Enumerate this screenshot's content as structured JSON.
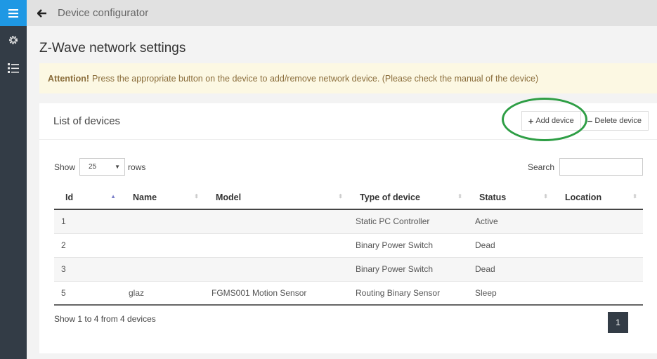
{
  "topbar": {
    "title": "Device configurator"
  },
  "page": {
    "title": "Z-Wave network settings"
  },
  "alert": {
    "strong": "Attention!",
    "text": "Press the appropriate button on the device to add/remove network device. (Please check the manual of the device)"
  },
  "card": {
    "title": "List of devices",
    "add_icon": "+",
    "add_label": "Add device",
    "delete_icon": "−",
    "delete_label": "Delete device"
  },
  "controls": {
    "show_label": "Show",
    "rows_value": "25",
    "rows_label": "rows",
    "search_label": "Search",
    "search_value": ""
  },
  "table": {
    "headers": [
      "Id",
      "Name",
      "Model",
      "Type of device",
      "Status",
      "Location"
    ],
    "rows": [
      [
        "1",
        "",
        "",
        "Static PC Controller",
        "Active",
        ""
      ],
      [
        "2",
        "",
        "",
        "Binary Power Switch",
        "Dead",
        ""
      ],
      [
        "3",
        "",
        "",
        "Binary Power Switch",
        "Dead",
        ""
      ],
      [
        "5",
        "glaz",
        "FGMS001 Motion Sensor",
        "Routing Binary Sensor",
        "Sleep",
        ""
      ]
    ]
  },
  "footer": {
    "info": "Show 1 to 4 from 4 devices",
    "page": "1"
  },
  "colors": {
    "accent": "#1e98e4",
    "sidebar": "#333c46",
    "alert_bg": "#fcf8e3",
    "highlight": "#2e9e45"
  }
}
